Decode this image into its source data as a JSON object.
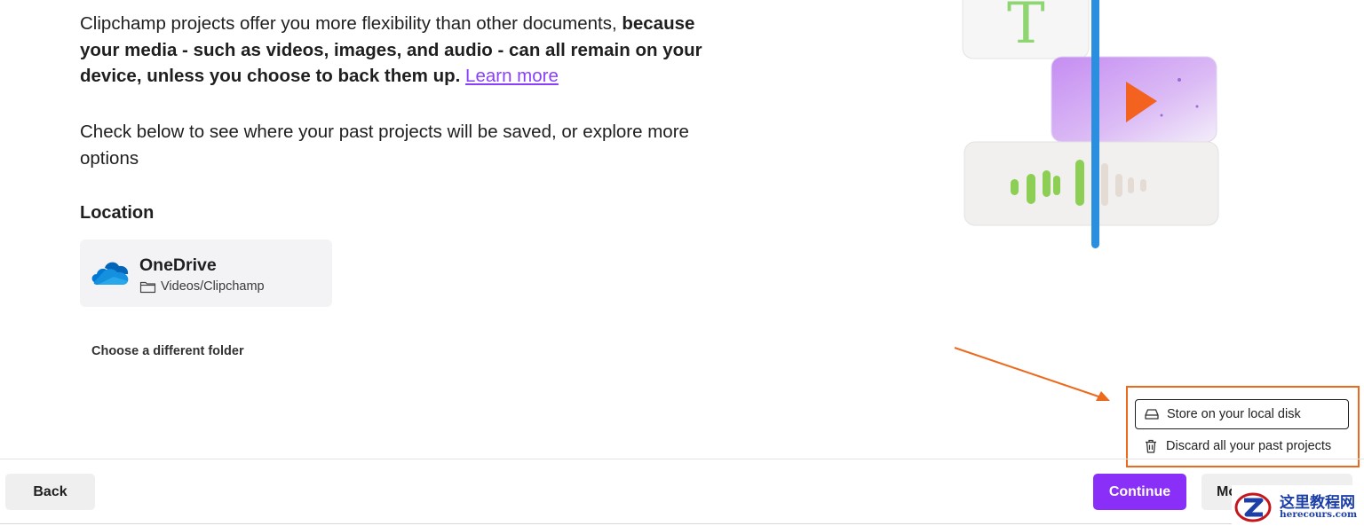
{
  "intro": {
    "regular": "Clipchamp projects offer you more flexibility than other documents, ",
    "bold": "because your media - such as videos, images, and audio - can all remain on your device, unless you choose to back them up.",
    "link": "Learn more"
  },
  "check_text": "Check below to see where your past projects will be saved, or explore more options",
  "location": {
    "heading": "Location",
    "name": "OneDrive",
    "path": "Videos/Clipchamp",
    "icon": "onedrive-cloud-icon",
    "folder_icon": "folder-icon"
  },
  "choose_folder": "Choose a different folder",
  "menu": {
    "items": [
      {
        "label": "Store on your local disk",
        "icon": "disk-icon",
        "selected": true
      },
      {
        "label": "Discard all your past projects",
        "icon": "trash-icon",
        "selected": false
      }
    ]
  },
  "footer": {
    "back": "Back",
    "continue": "Continue",
    "more": "More options"
  },
  "watermark": {
    "main": "这里教程网",
    "sub": "herecours.com"
  },
  "colors": {
    "accent": "#8a2ff7",
    "link": "#8a3ffc",
    "annotation": "#ec6a1e"
  }
}
